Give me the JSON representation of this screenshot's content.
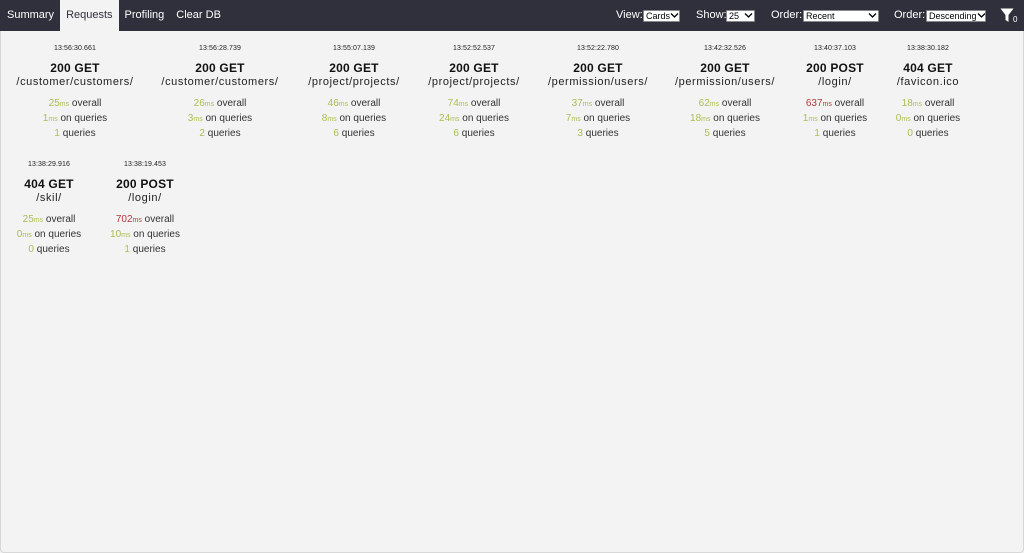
{
  "nav": {
    "tabs": [
      {
        "label": "Summary",
        "active": false
      },
      {
        "label": "Requests",
        "active": true
      },
      {
        "label": "Profiling",
        "active": false
      },
      {
        "label": "Clear DB",
        "active": false
      }
    ]
  },
  "controls": {
    "view": {
      "label": "View:",
      "value": "Cards"
    },
    "show": {
      "label": "Show:",
      "value": "25"
    },
    "order_by": {
      "label": "Order:",
      "value": "Recent"
    },
    "order_dir": {
      "label": "Order:",
      "value": "Descending"
    },
    "filter_count": "0"
  },
  "colors": {
    "topbar": "#30303d",
    "ok_number": "#a9bf52",
    "slow_number": "#b33a3a"
  },
  "requests": [
    {
      "time": "13:56:30.661",
      "status": "200 GET",
      "path": "/customer/customers/",
      "overall": "25",
      "overall_slow": false,
      "on_queries": "1",
      "queries": "1"
    },
    {
      "time": "13:56:28.739",
      "status": "200 GET",
      "path": "/customer/customers/",
      "overall": "26",
      "overall_slow": false,
      "on_queries": "3",
      "queries": "2"
    },
    {
      "time": "13:55:07.139",
      "status": "200 GET",
      "path": "/project/projects/",
      "overall": "46",
      "overall_slow": false,
      "on_queries": "8",
      "queries": "6"
    },
    {
      "time": "13:52:52.537",
      "status": "200 GET",
      "path": "/project/projects/",
      "overall": "74",
      "overall_slow": false,
      "on_queries": "24",
      "queries": "6"
    },
    {
      "time": "13:52:22.780",
      "status": "200 GET",
      "path": "/permission/users/",
      "overall": "37",
      "overall_slow": false,
      "on_queries": "7",
      "queries": "3"
    },
    {
      "time": "13:42:32.526",
      "status": "200 GET",
      "path": "/permission/users/",
      "overall": "62",
      "overall_slow": false,
      "on_queries": "18",
      "queries": "5"
    },
    {
      "time": "13:40:37.103",
      "status": "200 POST",
      "path": "/login/",
      "overall": "637",
      "overall_slow": true,
      "on_queries": "1",
      "queries": "1"
    },
    {
      "time": "13:38:30.182",
      "status": "404 GET",
      "path": "/favicon.ico",
      "overall": "18",
      "overall_slow": false,
      "on_queries": "0",
      "queries": "0"
    },
    {
      "time": "13:38:29.916",
      "status": "404 GET",
      "path": "/skil/",
      "overall": "25",
      "overall_slow": false,
      "on_queries": "0",
      "queries": "0"
    },
    {
      "time": "13:38:19.453",
      "status": "200 POST",
      "path": "/login/",
      "overall": "702",
      "overall_slow": true,
      "on_queries": "10",
      "queries": "1"
    }
  ],
  "labels": {
    "ms_unit": "ms",
    "overall_suffix": "overall",
    "on_queries_suffix": "on queries",
    "queries_suffix": "queries"
  }
}
